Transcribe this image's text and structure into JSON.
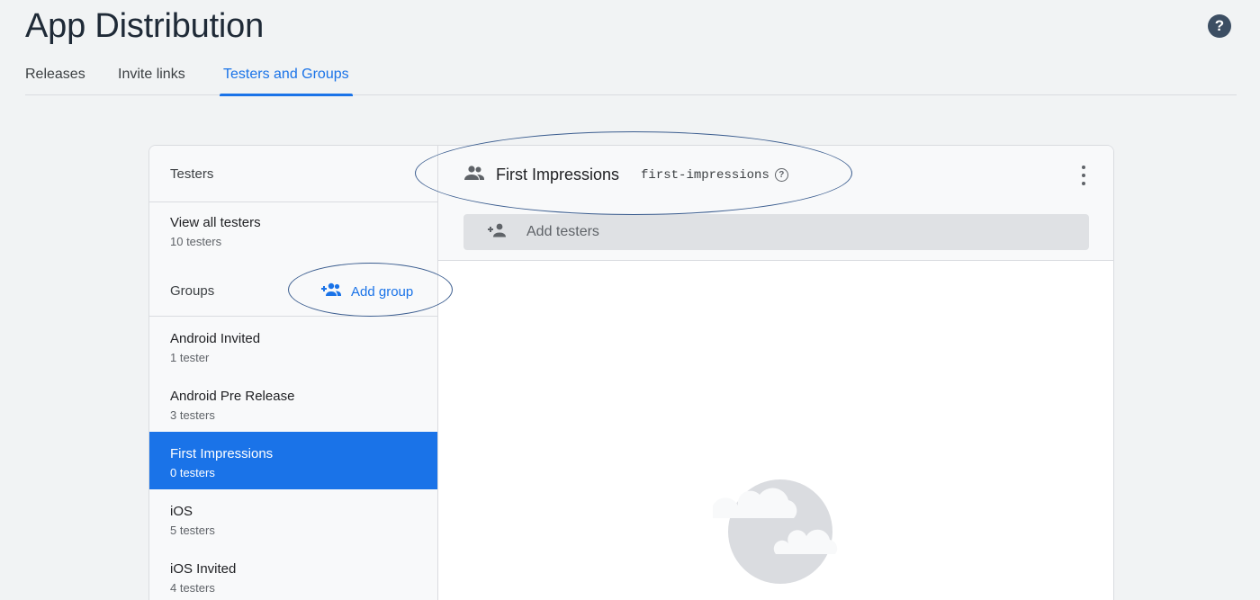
{
  "page": {
    "title": "App Distribution",
    "help_symbol": "?"
  },
  "tabs": [
    {
      "label": "Releases",
      "active": false
    },
    {
      "label": "Invite links",
      "active": false
    },
    {
      "label": "Testers and Groups",
      "active": true
    }
  ],
  "sidebar": {
    "header": "Testers",
    "view_all": {
      "title": "View all testers",
      "count": "10 testers"
    },
    "groups_label": "Groups",
    "add_group_label": "Add group",
    "groups": [
      {
        "name": "Android Invited",
        "count": "1 tester",
        "selected": false
      },
      {
        "name": "Android Pre Release",
        "count": "3 testers",
        "selected": false
      },
      {
        "name": "First Impressions",
        "count": "0 testers",
        "selected": true
      },
      {
        "name": "iOS",
        "count": "5 testers",
        "selected": false
      },
      {
        "name": "iOS Invited",
        "count": "4 testers",
        "selected": false
      }
    ]
  },
  "detail": {
    "group_name": "First Impressions",
    "group_alias": "first-impressions",
    "add_testers_placeholder": "Add testers"
  },
  "colors": {
    "accent": "#1a73e8",
    "annotation": "#3b5d8f"
  }
}
